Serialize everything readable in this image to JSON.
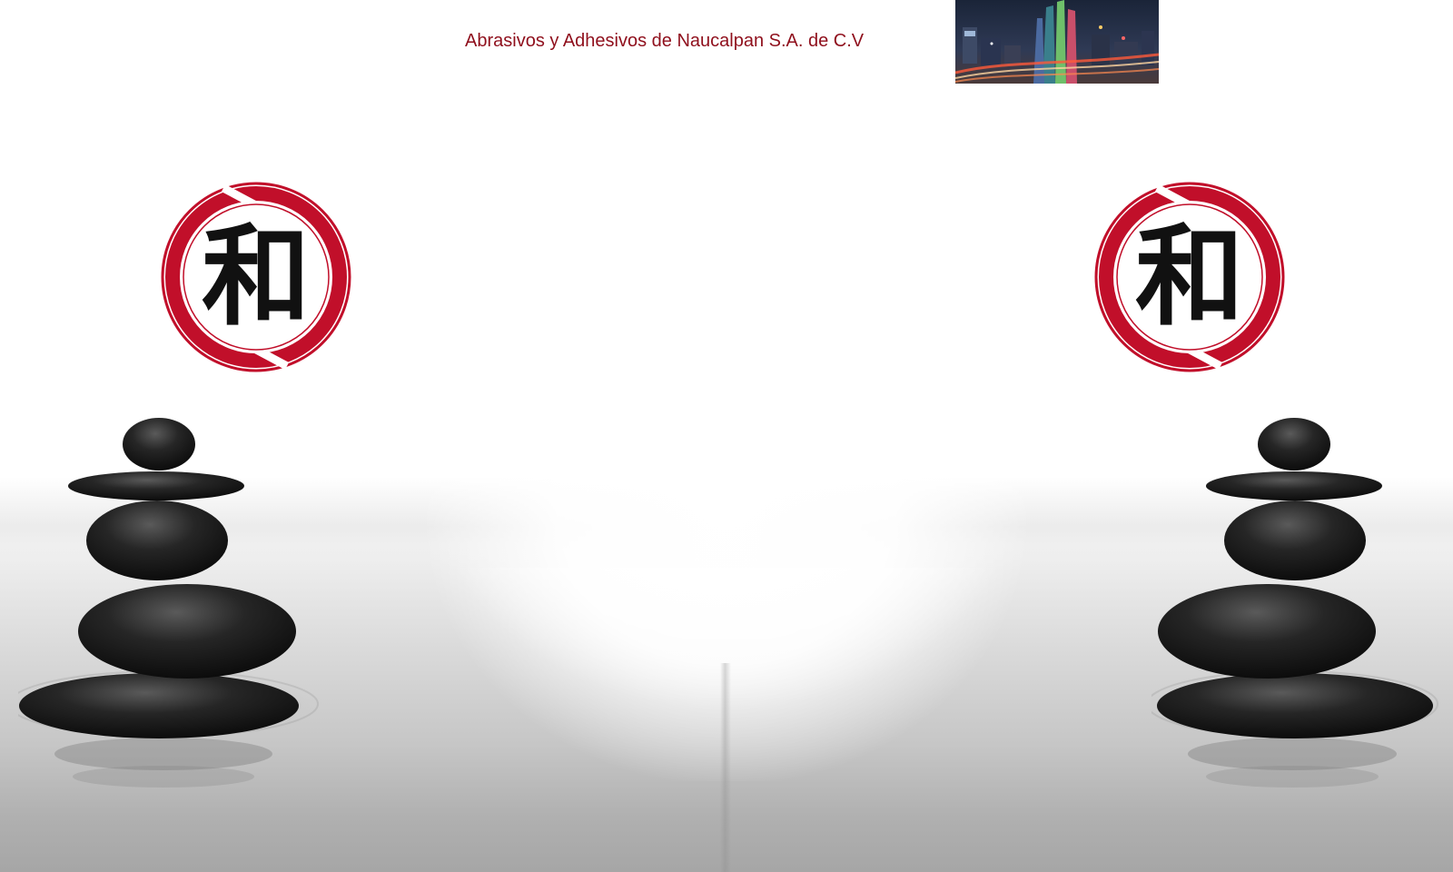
{
  "header": {
    "company_name": "Abrasivos y Adhesivos de Naucalpan S.A. de C.V"
  },
  "logo": {
    "glyph": "和",
    "ring_color": "#c10f2a",
    "glyph_color": "#111111"
  },
  "colors": {
    "title": "#8f0f1c",
    "stone": "#1c1c1c"
  },
  "icons": [
    "kanji-logo-icon",
    "stone-cairn-image",
    "city-night-photo"
  ]
}
